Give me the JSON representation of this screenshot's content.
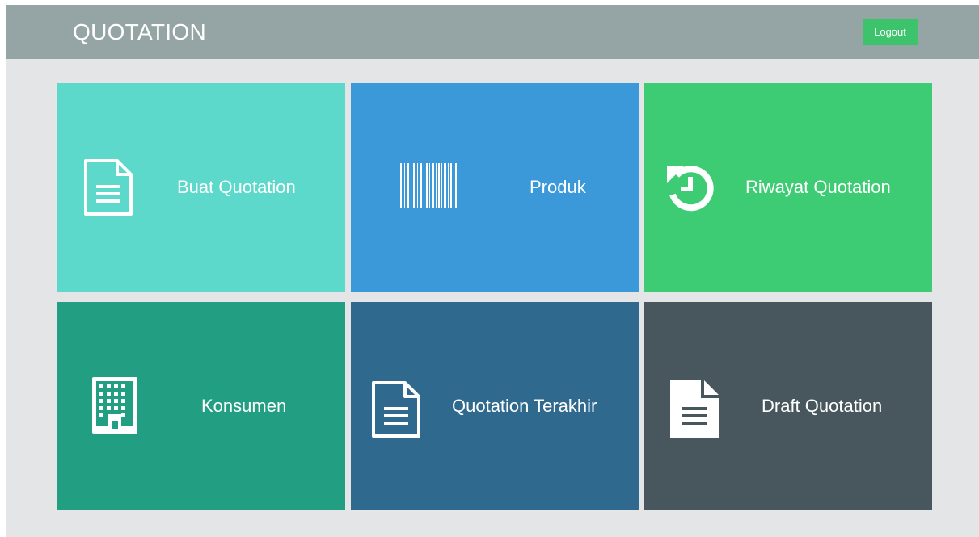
{
  "header": {
    "title": "QUOTATION",
    "logout_label": "Logout"
  },
  "menu": {
    "tiles": [
      {
        "label": "Buat Quotation",
        "icon": "document-icon",
        "color": "#5cd9cb"
      },
      {
        "label": "Produk",
        "icon": "barcode-icon",
        "color": "#3b98d9"
      },
      {
        "label": "Riwayat Quotation",
        "icon": "history-icon",
        "color": "#3dcc73"
      },
      {
        "label": "Konsumen",
        "icon": "building-icon",
        "color": "#229e83"
      },
      {
        "label": "Quotation Terakhir",
        "icon": "document-icon",
        "color": "#2f6a8e"
      },
      {
        "label": "Draft Quotation",
        "icon": "document-filled-icon",
        "color": "#48575e"
      }
    ]
  }
}
